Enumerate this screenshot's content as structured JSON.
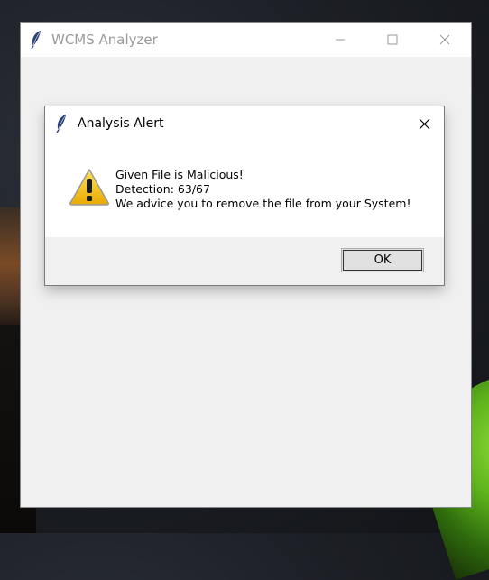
{
  "main_window": {
    "title": "WCMS Analyzer",
    "icon": "feather-icon",
    "controls": {
      "minimize": "minimize-icon",
      "maximize": "maximize-icon",
      "close": "close-icon"
    }
  },
  "dialog": {
    "title": "Analysis Alert",
    "icon": "feather-icon",
    "status_icon": "warning-icon",
    "message_lines": [
      "Given File is Malicious!",
      "Detection: 63/67",
      "We advice you to remove the file from your System!"
    ],
    "ok_label": "OK"
  },
  "colors": {
    "warning_yellow": "#f5c400",
    "window_bg": "#f0f0f0",
    "title_text": "#9a9a9a"
  }
}
